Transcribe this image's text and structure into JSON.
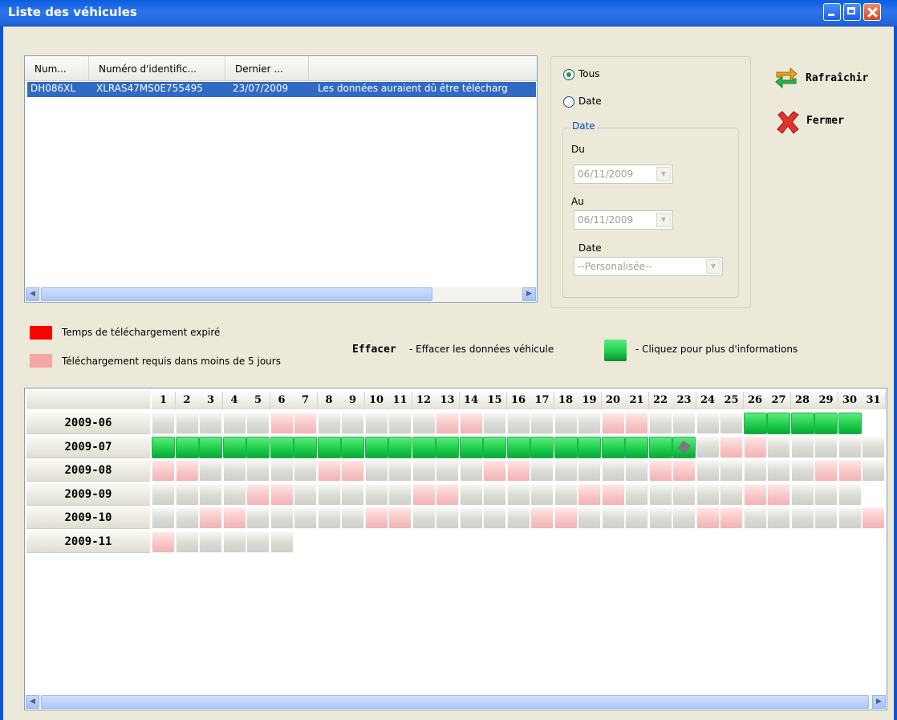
{
  "window": {
    "title": "Liste des véhicules"
  },
  "vehicle_list": {
    "columns": [
      "Num...",
      "Numéro d'identific...",
      "Dernier ..."
    ],
    "rows": [
      {
        "num": "DH086XL",
        "vin": "XLRAS47MS0E755495",
        "last": "23/07/2009",
        "status": "Les données auraient dû être télécharg"
      }
    ]
  },
  "filters": {
    "all_label": "Tous",
    "date_label": "Date",
    "all_selected": true,
    "group_title": "Date",
    "from_label": "Du",
    "from_value": "06/11/2009",
    "to_label": "Au",
    "to_value": "06/11/2009",
    "period_label": "Date",
    "period_value": "--Personalisée--"
  },
  "actions": {
    "refresh": "Rafraîchir",
    "close": "Fermer"
  },
  "legend": {
    "expired_color": "#ff0000",
    "expired_label": "Temps de téléchargement expiré",
    "soon_color": "#f6a6a6",
    "soon_label": "Téléchargement requis dans moins de 5 jours",
    "erase_keyword": "Effacer",
    "erase_desc": "- Effacer les données véhicule",
    "click_desc": "- Cliquez pour plus d'informations"
  },
  "calendar": {
    "days": [
      "1",
      "2",
      "3",
      "4",
      "5",
      "6",
      "7",
      "8",
      "9",
      "10",
      "11",
      "12",
      "13",
      "14",
      "15",
      "16",
      "17",
      "18",
      "19",
      "20",
      "21",
      "22",
      "23",
      "24",
      "25",
      "26",
      "27",
      "28",
      "29",
      "30",
      "31"
    ],
    "months": [
      {
        "label": "2009-06",
        "ndays": 30,
        "pink": [
          6,
          7,
          13,
          14,
          20,
          21
        ],
        "green": [
          26,
          27,
          28,
          29,
          30
        ]
      },
      {
        "label": "2009-07",
        "ndays": 31,
        "pink": [
          25,
          26
        ],
        "green": [
          1,
          2,
          3,
          4,
          5,
          6,
          7,
          8,
          9,
          10,
          11,
          12,
          13,
          14,
          15,
          16,
          17,
          18,
          19,
          20,
          21,
          22,
          23
        ],
        "grab_day": 23
      },
      {
        "label": "2009-08",
        "ndays": 31,
        "pink": [
          1,
          2,
          8,
          9,
          15,
          16,
          22,
          23,
          29,
          30
        ],
        "green": []
      },
      {
        "label": "2009-09",
        "ndays": 30,
        "pink": [
          5,
          6,
          12,
          13,
          19,
          20,
          26,
          27
        ],
        "green": []
      },
      {
        "label": "2009-10",
        "ndays": 31,
        "pink": [
          3,
          4,
          10,
          11,
          17,
          18,
          24,
          25,
          31
        ],
        "green": []
      },
      {
        "label": "2009-11",
        "ndays": 6,
        "pink": [
          1
        ],
        "green": []
      }
    ]
  }
}
